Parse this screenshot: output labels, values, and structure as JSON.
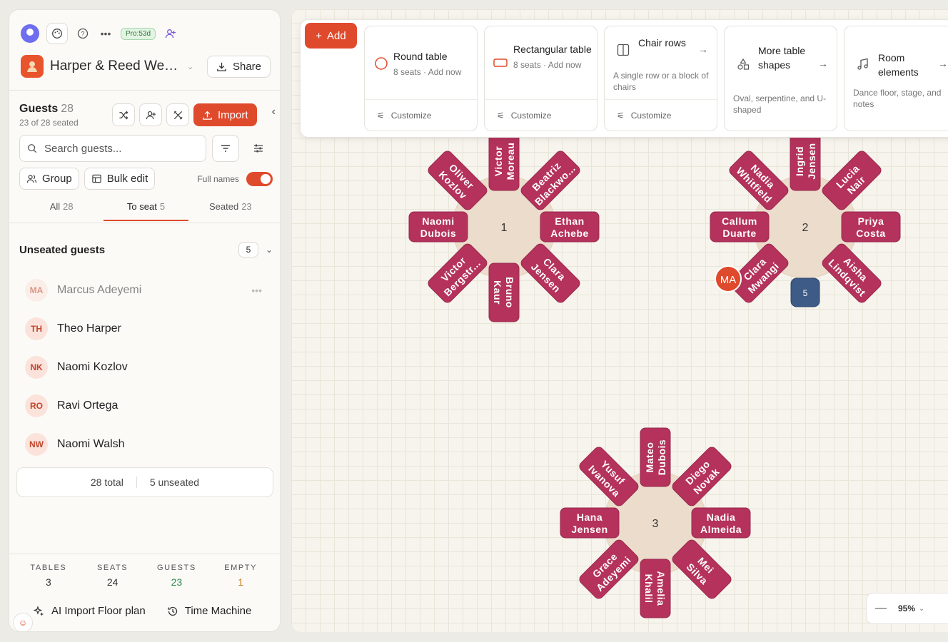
{
  "topbar": {
    "pro_badge": "Pro:53d"
  },
  "event": {
    "title": "Harper & Reed Wedding",
    "share_label": "Share"
  },
  "guests": {
    "title": "Guests",
    "count": "28",
    "subtitle": "23 of 28 seated",
    "import_label": "Import",
    "search_placeholder": "Search guests...",
    "group_label": "Group",
    "bulk_edit_label": "Bulk edit",
    "full_names_label": "Full names",
    "full_names_on": true,
    "tabs": [
      {
        "label": "All",
        "count": "28"
      },
      {
        "label": "To seat",
        "count": "5"
      },
      {
        "label": "Seated",
        "count": "23"
      }
    ],
    "unseated_title": "Unseated guests",
    "unseated_count": "5",
    "unseated": [
      {
        "initials": "MA",
        "name": "Marcus Adeyemi"
      },
      {
        "initials": "TH",
        "name": "Theo Harper"
      },
      {
        "initials": "NK",
        "name": "Naomi Kozlov"
      },
      {
        "initials": "RO",
        "name": "Ravi Ortega"
      },
      {
        "initials": "NW",
        "name": "Naomi Walsh"
      }
    ],
    "total_label": "28 total",
    "unseated_label": "5 unseated"
  },
  "stats": [
    {
      "label": "TABLES",
      "value": "3"
    },
    {
      "label": "SEATS",
      "value": "24"
    },
    {
      "label": "GUESTS",
      "value": "23"
    },
    {
      "label": "EMPTY",
      "value": "1"
    }
  ],
  "bottom_links": {
    "ai_import": "AI Import Floor plan",
    "time_machine": "Time Machine"
  },
  "toolbar": {
    "add_label": "Add",
    "cards": [
      {
        "title": "Round table",
        "sub": "8 seats · Add now",
        "foot": "Customize"
      },
      {
        "title": "Rectangular table",
        "sub": "8 seats · Add now",
        "foot": "Customize"
      },
      {
        "title": "Chair rows",
        "sub": "A single row or a block of chairs",
        "foot": "Customize"
      },
      {
        "title": "More table shapes",
        "sub": "Oval, serpentine, and U-shaped",
        "foot": ""
      },
      {
        "title": "Room elements",
        "sub": "Dance floor, stage, and notes",
        "foot": ""
      }
    ]
  },
  "floor": {
    "tables": [
      {
        "number": "1",
        "seats": [
          "Victor Moreau",
          "Beatriz Blackwo...",
          "Ethan Achebe",
          "Clara Jensen",
          "Bruno Kaur",
          "Victor Bergstr...",
          "Naomi Dubois",
          "Oliver Kozlov"
        ]
      },
      {
        "number": "2",
        "seats": [
          "Ingrid Jensen",
          "Lucia Nair",
          "Priya Costa",
          "Aisha Lindqvist",
          "",
          "Clara Mwangi",
          "Callum Duarte",
          "Nadia Whitfield"
        ]
      },
      {
        "number": "3",
        "seats": [
          "Mateo Dubois",
          "Diego Novak",
          "Nadia Almeida",
          "Mei Silva",
          "Amelia Khalil",
          "Grace Adeyemi",
          "Hana Jensen",
          "Yusuf Ivanova"
        ]
      }
    ],
    "drag_avatar": "MA",
    "empty_seat_label": "5"
  },
  "zoom": {
    "value": "95%"
  }
}
